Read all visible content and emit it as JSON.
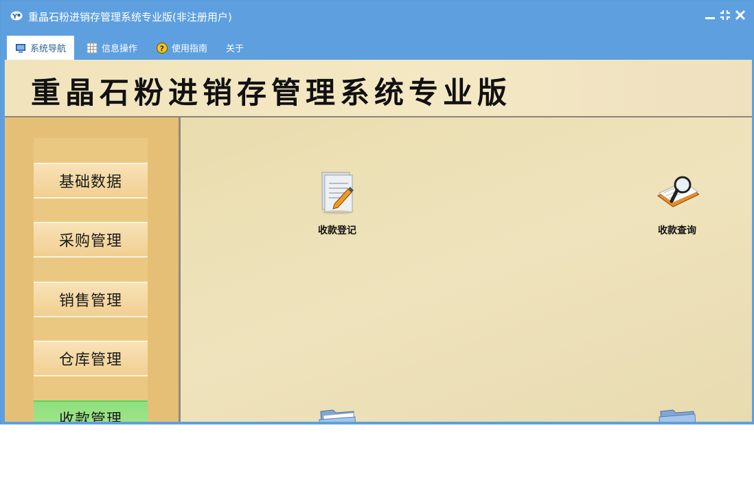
{
  "window": {
    "title": "重晶石粉进销存管理系统专业版(非注册用户)"
  },
  "menu": {
    "items": [
      {
        "label": "系统导航",
        "icon": "monitor-icon",
        "active": true
      },
      {
        "label": "信息操作",
        "icon": "grid-icon",
        "active": false
      },
      {
        "label": "使用指南",
        "icon": "help-icon",
        "active": false
      },
      {
        "label": "关于",
        "icon": "",
        "active": false
      }
    ]
  },
  "banner": {
    "title": "重晶石粉进销存管理系统专业版"
  },
  "sidebar": {
    "items": [
      {
        "label": "基础数据",
        "active": false
      },
      {
        "label": "采购管理",
        "active": false
      },
      {
        "label": "销售管理",
        "active": false
      },
      {
        "label": "仓库管理",
        "active": false
      },
      {
        "label": "收款管理",
        "active": true
      }
    ]
  },
  "main": {
    "functions": [
      {
        "label": "收款登记",
        "icon": "document-edit-icon"
      },
      {
        "label": "收款查询",
        "icon": "book-search-icon"
      },
      {
        "label": "",
        "icon": "folder-icon"
      },
      {
        "label": "",
        "icon": "folder-icon"
      }
    ]
  },
  "colors": {
    "titlebar": "#5ea0df",
    "banner": "#f1e4bc",
    "sidebar": "#e6bf76",
    "nav_button": "#f1cf92",
    "nav_active": "#8ee07e",
    "main_bg": "#e9ddae"
  }
}
